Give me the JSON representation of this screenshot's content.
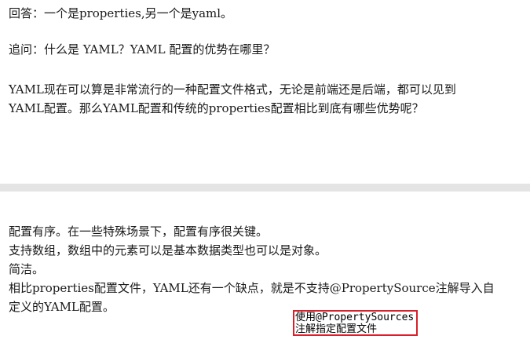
{
  "top": {
    "answer": "回答：一个是properties,另一个是yaml。",
    "question": "追问：什么是 YAML？YAML 配置的优势在哪里？",
    "para_line1": "YAML现在可以算是非常流行的一种配置文件格式，无论是前端还是后端，都可以见到",
    "para_line2": "YAML配置。那么YAML配置和传统的properties配置相比到底有哪些优势呢？"
  },
  "bottom": {
    "line1": "配置有序。在一些特殊场景下，配置有序很关键。",
    "line2": "支持数组，数组中的元素可以是基本数据类型也可以是对象。",
    "line3": "简洁。",
    "line4": "相比properties配置文件，YAML还有一个缺点，就是不支持@PropertySource注解导入自",
    "line5": "定义的YAML配置。"
  },
  "annotation": {
    "line1": "使用@PropertySources",
    "line2": "注解指定配置文件",
    "border_color": "#d8202a"
  }
}
